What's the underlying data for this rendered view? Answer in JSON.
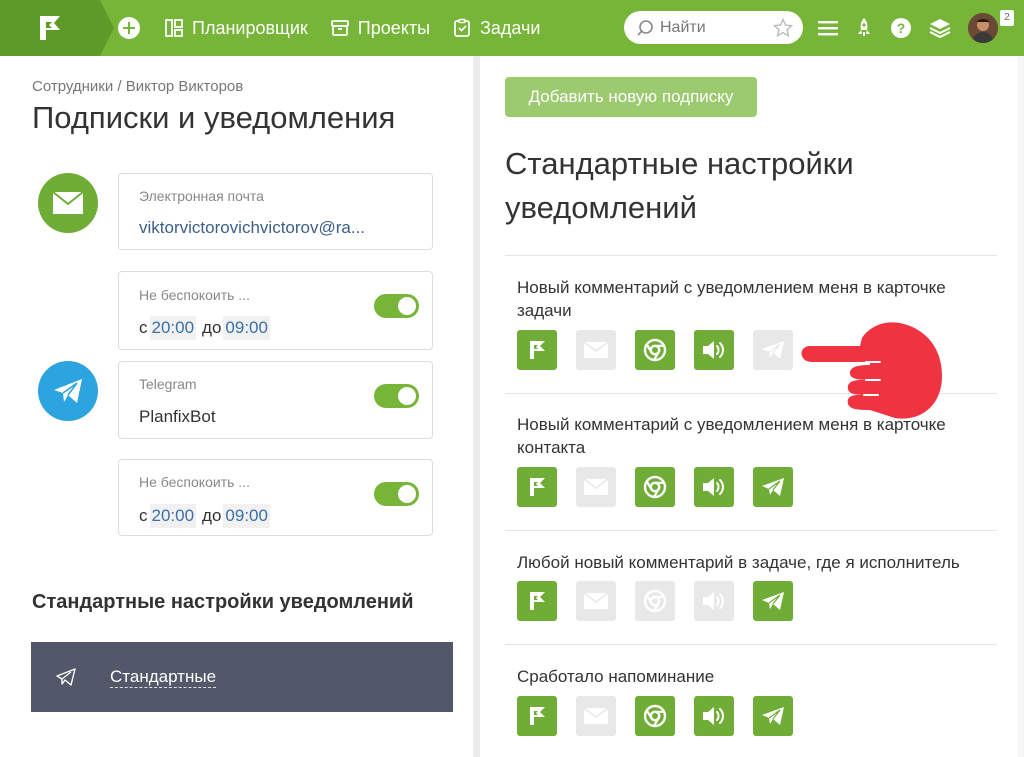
{
  "header": {
    "nav": [
      {
        "label": "Планировщик",
        "icon": "planner-icon"
      },
      {
        "label": "Проекты",
        "icon": "projects-icon"
      },
      {
        "label": "Задачи",
        "icon": "tasks-icon"
      }
    ],
    "search_placeholder": "Найти",
    "avatar_badge": "2",
    "accent": "#76b538"
  },
  "left": {
    "breadcrumb": "Сотрудники / Виктор Викторов",
    "title": "Подписки и уведомления",
    "email": {
      "label": "Электронная почта",
      "value": "viktorvictorovichvictorov@ra..."
    },
    "dnd1": {
      "label": "Не беспокоить ...",
      "from_word": "с",
      "from": "20:00",
      "to_word": "до",
      "to": "09:00",
      "enabled": true
    },
    "telegram": {
      "label": "Telegram",
      "value": "PlanfixBot",
      "enabled": true
    },
    "dnd2": {
      "label": "Не беспокоить ...",
      "from_word": "с",
      "from": "20:00",
      "to_word": "до",
      "to": "09:00",
      "enabled": true
    },
    "section_heading": "Стандартные настройки уведомлений",
    "preset_name": "Стандартные"
  },
  "right": {
    "add_button": "Добавить новую подписку",
    "title": "Стандартные настройки уведомлений",
    "events": [
      {
        "title": "Новый комментарий с уведомлением меня в карточке задачи",
        "channels": {
          "planfix": true,
          "email": false,
          "browser": true,
          "sound": true,
          "telegram": false
        }
      },
      {
        "title": "Новый комментарий с уведомлением меня в карточке контакта",
        "channels": {
          "planfix": true,
          "email": false,
          "browser": true,
          "sound": true,
          "telegram": true
        }
      },
      {
        "title": "Любой новый комментарий в задаче, где я исполнитель",
        "channels": {
          "planfix": true,
          "email": false,
          "browser": false,
          "sound": false,
          "telegram": true
        }
      },
      {
        "title": "Сработало напоминание",
        "channels": {
          "planfix": true,
          "email": false,
          "browser": true,
          "sound": true,
          "telegram": true
        }
      }
    ]
  }
}
